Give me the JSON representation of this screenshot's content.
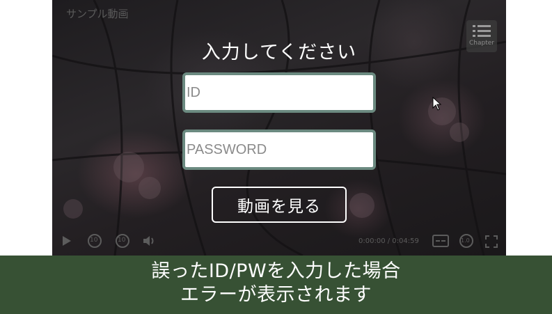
{
  "player": {
    "video_title": "サンプル動画",
    "chapter_label": "Chapter",
    "prompt": "入力してください",
    "id_placeholder": "ID",
    "password_placeholder": "PASSWORD",
    "submit_label": "動画を見る",
    "controls": {
      "play_icon": "play-icon",
      "rewind_label": "10",
      "forward_label": "10",
      "volume_icon": "volume-icon",
      "time": "0:00:00 / 0:04:59",
      "captions_icon": "captions-icon",
      "speed_label": "1.0",
      "fullscreen_icon": "fullscreen-icon"
    }
  },
  "caption": {
    "line1": "誤ったID/PWを入力した場合",
    "line2": "エラーが表示されます"
  },
  "colors": {
    "caption_bg": "#375134",
    "field_border": "#6b8a80",
    "player_bg": "#231f22"
  }
}
